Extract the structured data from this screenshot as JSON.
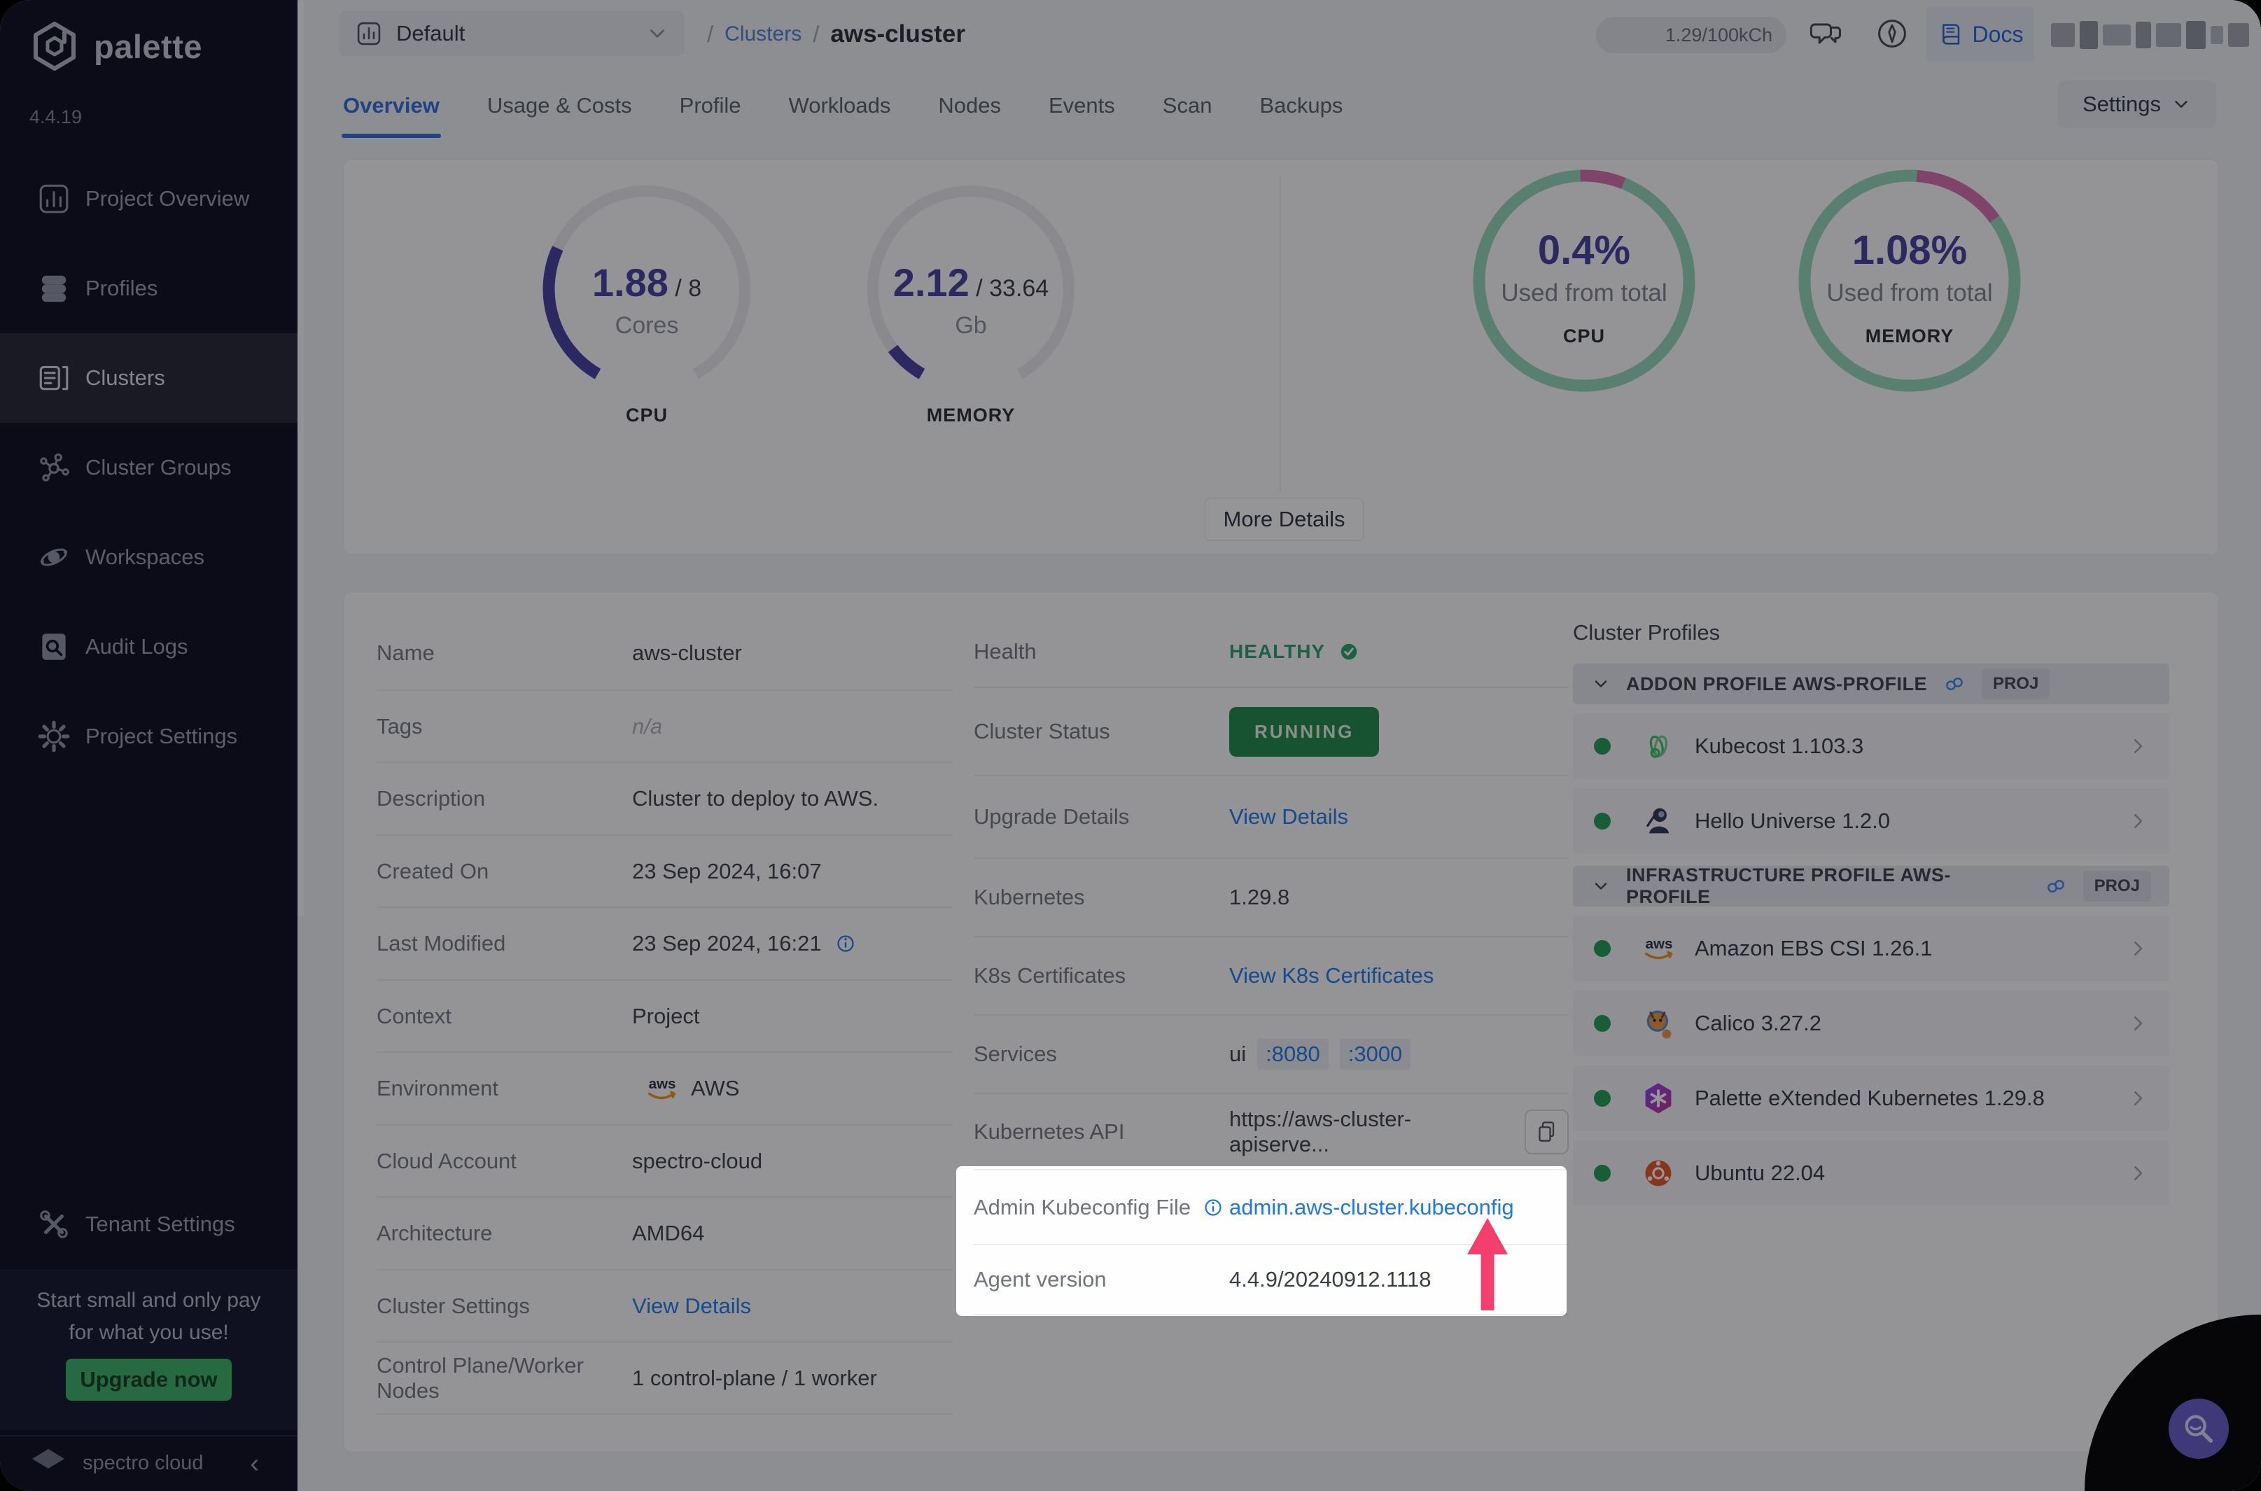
{
  "brand": {
    "logo_text": "palette",
    "version": "4.4.19",
    "footer_name": "spectro cloud",
    "collapse_glyph": "‹"
  },
  "sidebar": {
    "items": [
      {
        "label": "Project Overview",
        "icon": "project-overview",
        "active": false
      },
      {
        "label": "Profiles",
        "icon": "profiles",
        "active": false
      },
      {
        "label": "Clusters",
        "icon": "clusters",
        "active": true
      },
      {
        "label": "Cluster Groups",
        "icon": "cluster-groups",
        "active": false
      },
      {
        "label": "Workspaces",
        "icon": "workspaces",
        "active": false
      },
      {
        "label": "Audit Logs",
        "icon": "audit-logs",
        "active": false
      },
      {
        "label": "Project Settings",
        "icon": "project-settings",
        "active": false
      }
    ],
    "tenant": {
      "label": "Tenant Settings",
      "icon": "tenant-settings"
    },
    "promo": {
      "line1": "Start small and only pay",
      "line2": "for what you use!",
      "button": "Upgrade now"
    }
  },
  "topbar": {
    "project_selector": "Default",
    "breadcrumb": {
      "sep": "/",
      "root": "Clusters",
      "current": "aws-cluster"
    },
    "usage": "1.29/100kCh",
    "docs": "Docs"
  },
  "tabs": {
    "items": [
      "Overview",
      "Usage & Costs",
      "Profile",
      "Workloads",
      "Nodes",
      "Events",
      "Scan",
      "Backups"
    ],
    "active": "Overview",
    "settings": "Settings"
  },
  "overview": {
    "gauges": [
      {
        "id": "cpu",
        "used": 1.88,
        "total": 8,
        "used_text": "1.88",
        "total_text": "8",
        "unit": "Cores",
        "label": "CPU"
      },
      {
        "id": "memory",
        "used": 2.12,
        "total": 33.64,
        "used_text": "2.12",
        "total_text": "33.64",
        "unit": "Gb",
        "label": "MEMORY"
      }
    ],
    "donuts": [
      {
        "id": "cpu",
        "percent": "0.4%",
        "caption": "Used from total",
        "label": "CPU",
        "pink_start": -2,
        "pink_sweep": 24
      },
      {
        "id": "memory",
        "percent": "1.08%",
        "caption": "Used from total",
        "label": "MEMORY",
        "pink_start": 4,
        "pink_sweep": 50
      }
    ],
    "more_details": "More Details"
  },
  "details": {
    "left_rows": [
      {
        "label": "Name",
        "kind": "text",
        "value": "aws-cluster"
      },
      {
        "label": "Tags",
        "kind": "muted",
        "value": "n/a"
      },
      {
        "label": "Description",
        "kind": "text",
        "value": "Cluster to deploy to AWS."
      },
      {
        "label": "Created On",
        "kind": "text",
        "value": "23 Sep 2024, 16:07"
      },
      {
        "label": "Last Modified",
        "kind": "info-text",
        "value": "23 Sep 2024, 16:21"
      },
      {
        "label": "Context",
        "kind": "text",
        "value": "Project"
      },
      {
        "label": "Environment",
        "kind": "env",
        "value": "AWS"
      },
      {
        "label": "Cloud Account",
        "kind": "text",
        "value": "spectro-cloud"
      },
      {
        "label": "Architecture",
        "kind": "text",
        "value": "AMD64"
      },
      {
        "label": "Cluster Settings",
        "kind": "link",
        "value": "View Details"
      },
      {
        "label": "Control Plane/Worker Nodes",
        "kind": "text",
        "value": "1 control-plane / 1 worker"
      }
    ],
    "middle_rows": [
      {
        "label": "Health",
        "kind": "health",
        "value": "HEALTHY"
      },
      {
        "label": "Cluster Status",
        "kind": "status",
        "value": "RUNNING"
      },
      {
        "label": "Upgrade Details",
        "kind": "link",
        "value": "View Details"
      },
      {
        "label": "Kubernetes",
        "kind": "text",
        "value": "1.29.8"
      },
      {
        "label": "K8s Certificates",
        "kind": "link",
        "value": "View K8s Certificates"
      },
      {
        "label": "Services",
        "kind": "services",
        "prefix": "ui",
        "ports": [
          ":8080",
          ":3000"
        ]
      },
      {
        "label": "Kubernetes API",
        "kind": "api",
        "value": "https://aws-cluster-apiserve..."
      },
      {
        "label": "Admin Kubeconfig File",
        "kind": "kubeconfig",
        "label_info": true,
        "value": "admin.aws-cluster.kubeconfig"
      },
      {
        "label": "Agent version",
        "kind": "text",
        "value": "4.4.9/20240912.1118"
      }
    ]
  },
  "profiles": {
    "title": "Cluster Profiles",
    "sections": [
      {
        "header": "ADDON PROFILE AWS-PROFILE",
        "badge": "PROJ",
        "items": [
          {
            "name": "Kubecost 1.103.3",
            "icon": "kubecost"
          },
          {
            "name": "Hello Universe 1.2.0",
            "icon": "hello-universe"
          }
        ]
      },
      {
        "header": "INFRASTRUCTURE PROFILE AWS-PROFILE",
        "badge": "PROJ",
        "items": [
          {
            "name": "Amazon EBS CSI 1.26.1",
            "icon": "aws"
          },
          {
            "name": "Calico 3.27.2",
            "icon": "calico"
          },
          {
            "name": "Palette eXtended Kubernetes 1.29.8",
            "icon": "pxk"
          },
          {
            "name": "Ubuntu 22.04",
            "icon": "ubuntu"
          }
        ]
      }
    ]
  },
  "colors": {
    "accent_blue": "#1e79e8",
    "tab_blue": "#2e6cd6",
    "healthy_green": "#27a56b",
    "running_green": "#1f8a46",
    "gauge_purple": "#453e9d",
    "donut_green": "#93d8b6",
    "donut_pink": "#d96fae",
    "arrow_pink": "#f43f6e",
    "upgrade_green": "#3cb367",
    "fab_purple": "#675cc9",
    "sidebar_bg": "#0b0c1b"
  }
}
